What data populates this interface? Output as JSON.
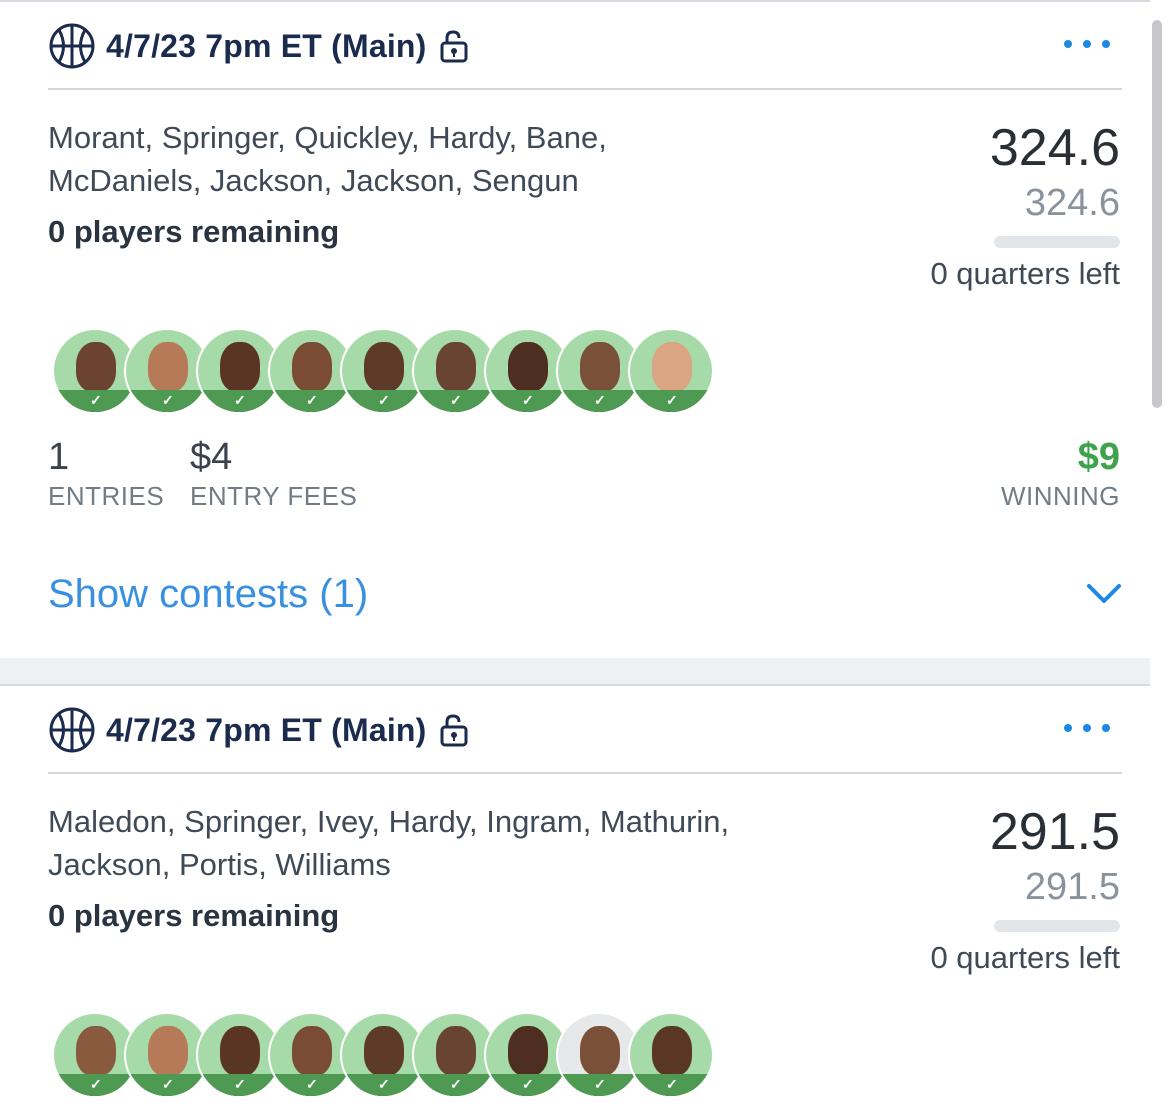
{
  "cards": [
    {
      "title": "4/7/23 7pm ET (Main)",
      "players_line1": "Morant, Springer, Quickley, Hardy, Bane,",
      "players_line2": "McDaniels, Jackson, Jackson, Sengun",
      "remaining": "0 players remaining",
      "score": "324.6",
      "projected": "324.6",
      "quarters_left": "0 quarters left",
      "entries_value": "1",
      "entries_label": "ENTRIES",
      "fees_value": "$4",
      "fees_label": "ENTRY FEES",
      "winning_value": "$9",
      "winning_label": "WINNING",
      "show_contests": "Show contests (1)",
      "avatar_count": 9
    },
    {
      "title": "4/7/23 7pm ET (Main)",
      "players_line1": "Maledon, Springer, Ivey, Hardy, Ingram, Mathurin,",
      "players_line2": "Jackson, Portis, Williams",
      "remaining": "0 players remaining",
      "score": "291.5",
      "projected": "291.5",
      "quarters_left": "0 quarters left",
      "avatar_count": 9
    }
  ],
  "colors": {
    "title": "#1b2b4d",
    "accent_blue": "#1e88e5",
    "win_green": "#3ea34b",
    "avatar_bg": "#a6dba9"
  },
  "icons": [
    "basketball-icon",
    "lock-icon",
    "more-icon",
    "chevron-down-icon",
    "check-icon"
  ]
}
